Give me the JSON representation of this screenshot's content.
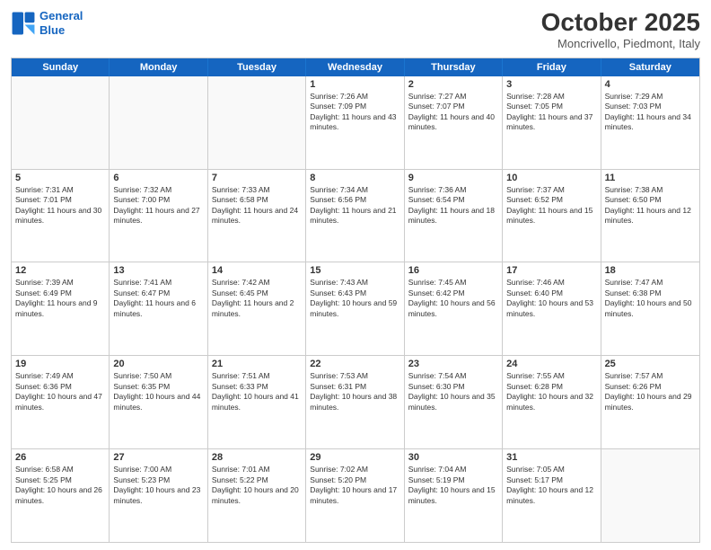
{
  "logo": {
    "line1": "General",
    "line2": "Blue"
  },
  "title": "October 2025",
  "subtitle": "Moncrivello, Piedmont, Italy",
  "dayHeaders": [
    "Sunday",
    "Monday",
    "Tuesday",
    "Wednesday",
    "Thursday",
    "Friday",
    "Saturday"
  ],
  "weeks": [
    [
      {
        "day": "",
        "empty": true
      },
      {
        "day": "",
        "empty": true
      },
      {
        "day": "",
        "empty": true
      },
      {
        "day": "1",
        "sunrise": "7:26 AM",
        "sunset": "7:09 PM",
        "daylight": "11 hours and 43 minutes."
      },
      {
        "day": "2",
        "sunrise": "7:27 AM",
        "sunset": "7:07 PM",
        "daylight": "11 hours and 40 minutes."
      },
      {
        "day": "3",
        "sunrise": "7:28 AM",
        "sunset": "7:05 PM",
        "daylight": "11 hours and 37 minutes."
      },
      {
        "day": "4",
        "sunrise": "7:29 AM",
        "sunset": "7:03 PM",
        "daylight": "11 hours and 34 minutes."
      }
    ],
    [
      {
        "day": "5",
        "sunrise": "7:31 AM",
        "sunset": "7:01 PM",
        "daylight": "11 hours and 30 minutes."
      },
      {
        "day": "6",
        "sunrise": "7:32 AM",
        "sunset": "7:00 PM",
        "daylight": "11 hours and 27 minutes."
      },
      {
        "day": "7",
        "sunrise": "7:33 AM",
        "sunset": "6:58 PM",
        "daylight": "11 hours and 24 minutes."
      },
      {
        "day": "8",
        "sunrise": "7:34 AM",
        "sunset": "6:56 PM",
        "daylight": "11 hours and 21 minutes."
      },
      {
        "day": "9",
        "sunrise": "7:36 AM",
        "sunset": "6:54 PM",
        "daylight": "11 hours and 18 minutes."
      },
      {
        "day": "10",
        "sunrise": "7:37 AM",
        "sunset": "6:52 PM",
        "daylight": "11 hours and 15 minutes."
      },
      {
        "day": "11",
        "sunrise": "7:38 AM",
        "sunset": "6:50 PM",
        "daylight": "11 hours and 12 minutes."
      }
    ],
    [
      {
        "day": "12",
        "sunrise": "7:39 AM",
        "sunset": "6:49 PM",
        "daylight": "11 hours and 9 minutes."
      },
      {
        "day": "13",
        "sunrise": "7:41 AM",
        "sunset": "6:47 PM",
        "daylight": "11 hours and 6 minutes."
      },
      {
        "day": "14",
        "sunrise": "7:42 AM",
        "sunset": "6:45 PM",
        "daylight": "11 hours and 2 minutes."
      },
      {
        "day": "15",
        "sunrise": "7:43 AM",
        "sunset": "6:43 PM",
        "daylight": "10 hours and 59 minutes."
      },
      {
        "day": "16",
        "sunrise": "7:45 AM",
        "sunset": "6:42 PM",
        "daylight": "10 hours and 56 minutes."
      },
      {
        "day": "17",
        "sunrise": "7:46 AM",
        "sunset": "6:40 PM",
        "daylight": "10 hours and 53 minutes."
      },
      {
        "day": "18",
        "sunrise": "7:47 AM",
        "sunset": "6:38 PM",
        "daylight": "10 hours and 50 minutes."
      }
    ],
    [
      {
        "day": "19",
        "sunrise": "7:49 AM",
        "sunset": "6:36 PM",
        "daylight": "10 hours and 47 minutes."
      },
      {
        "day": "20",
        "sunrise": "7:50 AM",
        "sunset": "6:35 PM",
        "daylight": "10 hours and 44 minutes."
      },
      {
        "day": "21",
        "sunrise": "7:51 AM",
        "sunset": "6:33 PM",
        "daylight": "10 hours and 41 minutes."
      },
      {
        "day": "22",
        "sunrise": "7:53 AM",
        "sunset": "6:31 PM",
        "daylight": "10 hours and 38 minutes."
      },
      {
        "day": "23",
        "sunrise": "7:54 AM",
        "sunset": "6:30 PM",
        "daylight": "10 hours and 35 minutes."
      },
      {
        "day": "24",
        "sunrise": "7:55 AM",
        "sunset": "6:28 PM",
        "daylight": "10 hours and 32 minutes."
      },
      {
        "day": "25",
        "sunrise": "7:57 AM",
        "sunset": "6:26 PM",
        "daylight": "10 hours and 29 minutes."
      }
    ],
    [
      {
        "day": "26",
        "sunrise": "6:58 AM",
        "sunset": "5:25 PM",
        "daylight": "10 hours and 26 minutes."
      },
      {
        "day": "27",
        "sunrise": "7:00 AM",
        "sunset": "5:23 PM",
        "daylight": "10 hours and 23 minutes."
      },
      {
        "day": "28",
        "sunrise": "7:01 AM",
        "sunset": "5:22 PM",
        "daylight": "10 hours and 20 minutes."
      },
      {
        "day": "29",
        "sunrise": "7:02 AM",
        "sunset": "5:20 PM",
        "daylight": "10 hours and 17 minutes."
      },
      {
        "day": "30",
        "sunrise": "7:04 AM",
        "sunset": "5:19 PM",
        "daylight": "10 hours and 15 minutes."
      },
      {
        "day": "31",
        "sunrise": "7:05 AM",
        "sunset": "5:17 PM",
        "daylight": "10 hours and 12 minutes."
      },
      {
        "day": "",
        "empty": true
      }
    ]
  ]
}
